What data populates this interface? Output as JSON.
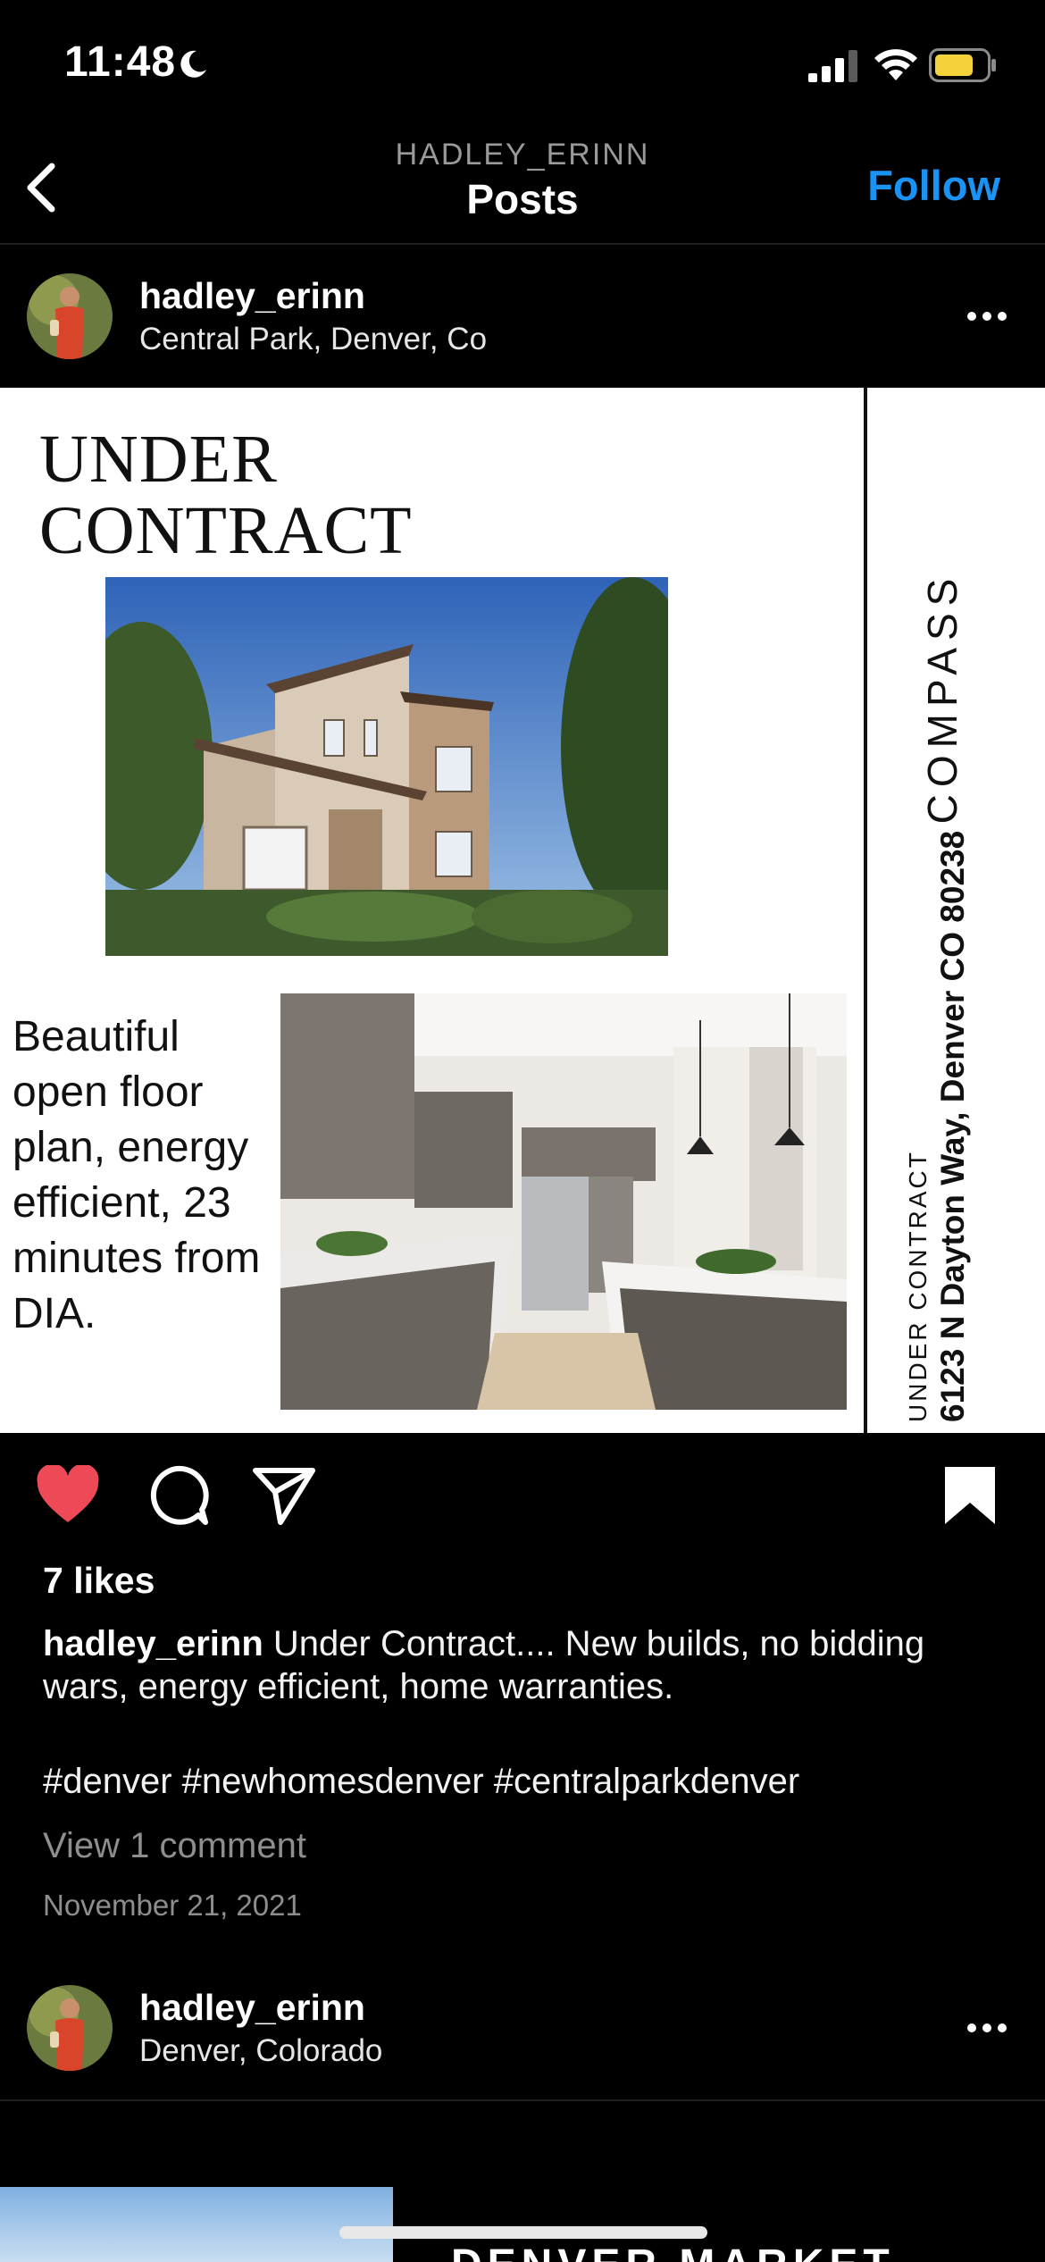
{
  "status_bar": {
    "time": "11:48"
  },
  "nav": {
    "subtitle": "HADLEY_ERINN",
    "title": "Posts",
    "follow_label": "Follow"
  },
  "post": {
    "username": "hadley_erinn",
    "location": "Central Park, Denver, Co",
    "image": {
      "headline_line1": "UNDER",
      "headline_line2": "CONTRACT",
      "description": "Beautiful open floor plan, energy efficient, 23 minutes from DIA.",
      "brand": "COMPASS",
      "side_label": "UNDER CONTRACT",
      "address": "6123 N Dayton Way, Denver CO 80238"
    },
    "liked": true,
    "likes": "7 likes",
    "caption_user": "hadley_erinn",
    "caption_text": " Under Contract.... New builds, no bidding wars, energy efficient, home warranties.",
    "hashtags": "#denver #newhomesdenver #centralparkdenver",
    "view_comments": "View 1 comment",
    "date": "November 21, 2021"
  },
  "next_post": {
    "username": "hadley_erinn",
    "location": "Denver, Colorado",
    "image_text": "DENVER MARKET STATS"
  },
  "colors": {
    "accent": "#1a93f5",
    "like": "#ed4956",
    "battery": "#f5d13b"
  }
}
